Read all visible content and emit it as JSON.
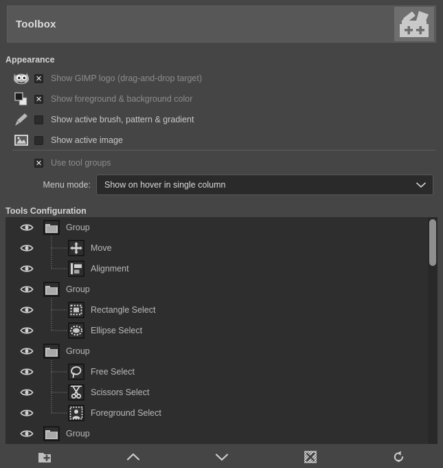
{
  "header": {
    "title": "Toolbox",
    "icon": "toolbox-icon"
  },
  "appearance": {
    "section_title": "Appearance",
    "items": [
      {
        "icon": "wilber-logo-icon",
        "label": "Show GIMP logo (drag-and-drop target)",
        "checked": true
      },
      {
        "icon": "foreground-background-color-icon",
        "label": "Show foreground & background color",
        "checked": true
      },
      {
        "icon": "paintbrush-icon",
        "label": "Show active brush, pattern & gradient",
        "checked": false
      },
      {
        "icon": "active-image-icon",
        "label": "Show active image",
        "checked": false
      }
    ],
    "use_tool_groups": {
      "label": "Use tool groups",
      "checked": true
    },
    "menu_mode": {
      "label": "Menu mode:",
      "value": "Show on hover in single column",
      "icon": "chevron-down-icon"
    }
  },
  "tools_configuration": {
    "section_title": "Tools Configuration",
    "rows": [
      {
        "label": "Group",
        "type": "group",
        "icon": "folder-icon",
        "visible": true
      },
      {
        "label": "Move",
        "type": "child",
        "icon": "move-icon",
        "visible": true
      },
      {
        "label": "Alignment",
        "type": "child",
        "icon": "alignment-icon",
        "visible": true
      },
      {
        "label": "Group",
        "type": "group",
        "icon": "folder-icon",
        "visible": true
      },
      {
        "label": "Rectangle Select",
        "type": "child",
        "icon": "rectangle-select-icon",
        "visible": true
      },
      {
        "label": "Ellipse Select",
        "type": "child",
        "icon": "ellipse-select-icon",
        "visible": true
      },
      {
        "label": "Group",
        "type": "group",
        "icon": "folder-icon",
        "visible": true
      },
      {
        "label": "Free Select",
        "type": "child",
        "icon": "free-select-icon",
        "visible": true
      },
      {
        "label": "Scissors Select",
        "type": "child",
        "icon": "scissors-select-icon",
        "visible": true
      },
      {
        "label": "Foreground Select",
        "type": "child",
        "icon": "foreground-select-icon",
        "visible": true
      },
      {
        "label": "Group",
        "type": "group",
        "icon": "folder-icon",
        "visible": true
      }
    ]
  },
  "bottom_toolbar": {
    "buttons": [
      {
        "name": "new-tool-group-button",
        "icon": "new-folder-icon"
      },
      {
        "name": "move-up-button",
        "icon": "chevron-up-icon"
      },
      {
        "name": "move-down-button",
        "icon": "chevron-down-icon"
      },
      {
        "name": "toggle-visibility-button",
        "icon": "checkered-visibility-icon"
      },
      {
        "name": "reset-button",
        "icon": "reset-arrow-icon"
      }
    ]
  },
  "colors": {
    "window_background": "#454545",
    "header_background": "#575757",
    "list_background": "#2e2e2e",
    "combo_background": "#2a2a2a",
    "text_normal": "#c9c9c9",
    "text_dim": "#8c8c8c",
    "icon_light": "#c8c8c8"
  }
}
